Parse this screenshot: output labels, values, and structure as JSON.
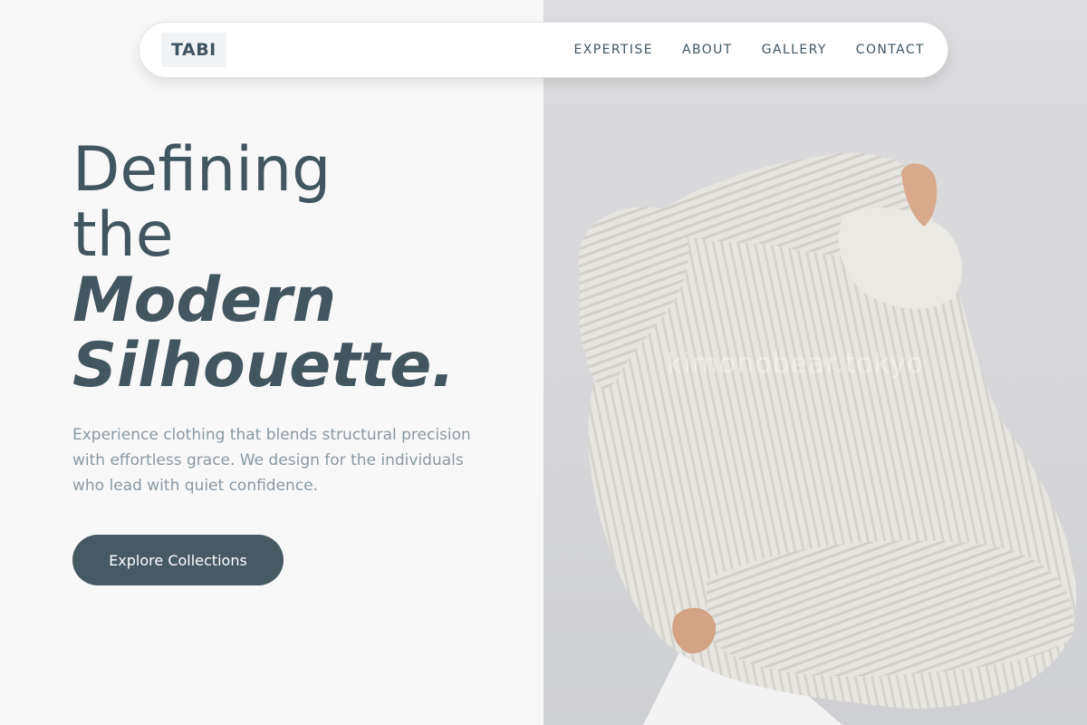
{
  "brand": {
    "logo_text": "TABI"
  },
  "nav": {
    "links": [
      {
        "label": "EXPERTISE"
      },
      {
        "label": "ABOUT"
      },
      {
        "label": "GALLERY"
      },
      {
        "label": "CONTACT"
      }
    ]
  },
  "hero": {
    "title_line_1": "Defining",
    "title_line_2": "the",
    "title_line_3": "Modern",
    "title_line_4": "Silhouette.",
    "description": "Experience clothing that blends structural precision with effortless grace. We design for the individuals who lead with quiet confidence.",
    "cta_label": "Explore Collections"
  },
  "image": {
    "subject": "person-pulling-on-white-knit-sweater",
    "watermark": "kimonobear.tokyo"
  },
  "colors": {
    "accent": "#465a64",
    "heading": "#42565f",
    "body_text": "#8899a3",
    "background": "#f8f8f8",
    "image_background": "#d8d8da"
  }
}
